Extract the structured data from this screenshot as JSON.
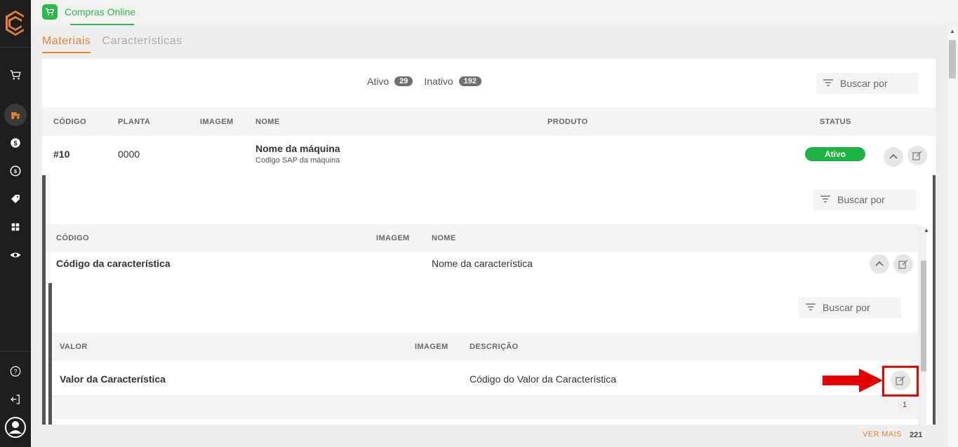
{
  "app": {
    "name": "Compras Online"
  },
  "colors": {
    "accent": "#e8832a",
    "green": "#2db84d",
    "active_status": "#1db342",
    "sidebar": "#1e1e1e",
    "annotation": "#e60000"
  },
  "sidebar": {
    "icons": [
      "cart-icon",
      "tractor-icon",
      "dollar-icon",
      "exchange-icon",
      "tag-icon",
      "grid-icon",
      "eye-icon",
      "help-icon",
      "logout-icon",
      "user-icon"
    ]
  },
  "tabs": [
    {
      "label": "Materiais",
      "active": true
    },
    {
      "label": "Características",
      "active": false
    }
  ],
  "counts": {
    "ativo_label": "Ativo",
    "ativo_count": "29",
    "inativo_label": "Inativo",
    "inativo_count": "192"
  },
  "search": {
    "placeholder": "Buscar por"
  },
  "materials_table": {
    "headers": [
      "CÓDIGO",
      "PLANTA",
      "IMAGEM",
      "NOME",
      "PRODUTO",
      "STATUS"
    ],
    "row": {
      "codigo": "#10",
      "planta": "0000",
      "nome": "Nome da máquina",
      "nome_sub": "Codigo SAP da máquina",
      "status": "Ativo"
    }
  },
  "characteristics_table": {
    "headers": [
      "CÓDIGO",
      "IMAGEM",
      "NOME"
    ],
    "row": {
      "codigo": "Código da característica",
      "nome": "Nome da característica"
    }
  },
  "values_table": {
    "headers": [
      "VALOR",
      "IMAGEM",
      "DESCRIÇÃO"
    ],
    "row": {
      "valor": "Valor da Característica",
      "descricao": "Código do Valor da Característica"
    },
    "page": "1"
  },
  "footer": {
    "ver_mais": "VER MAIS",
    "total": "221"
  }
}
